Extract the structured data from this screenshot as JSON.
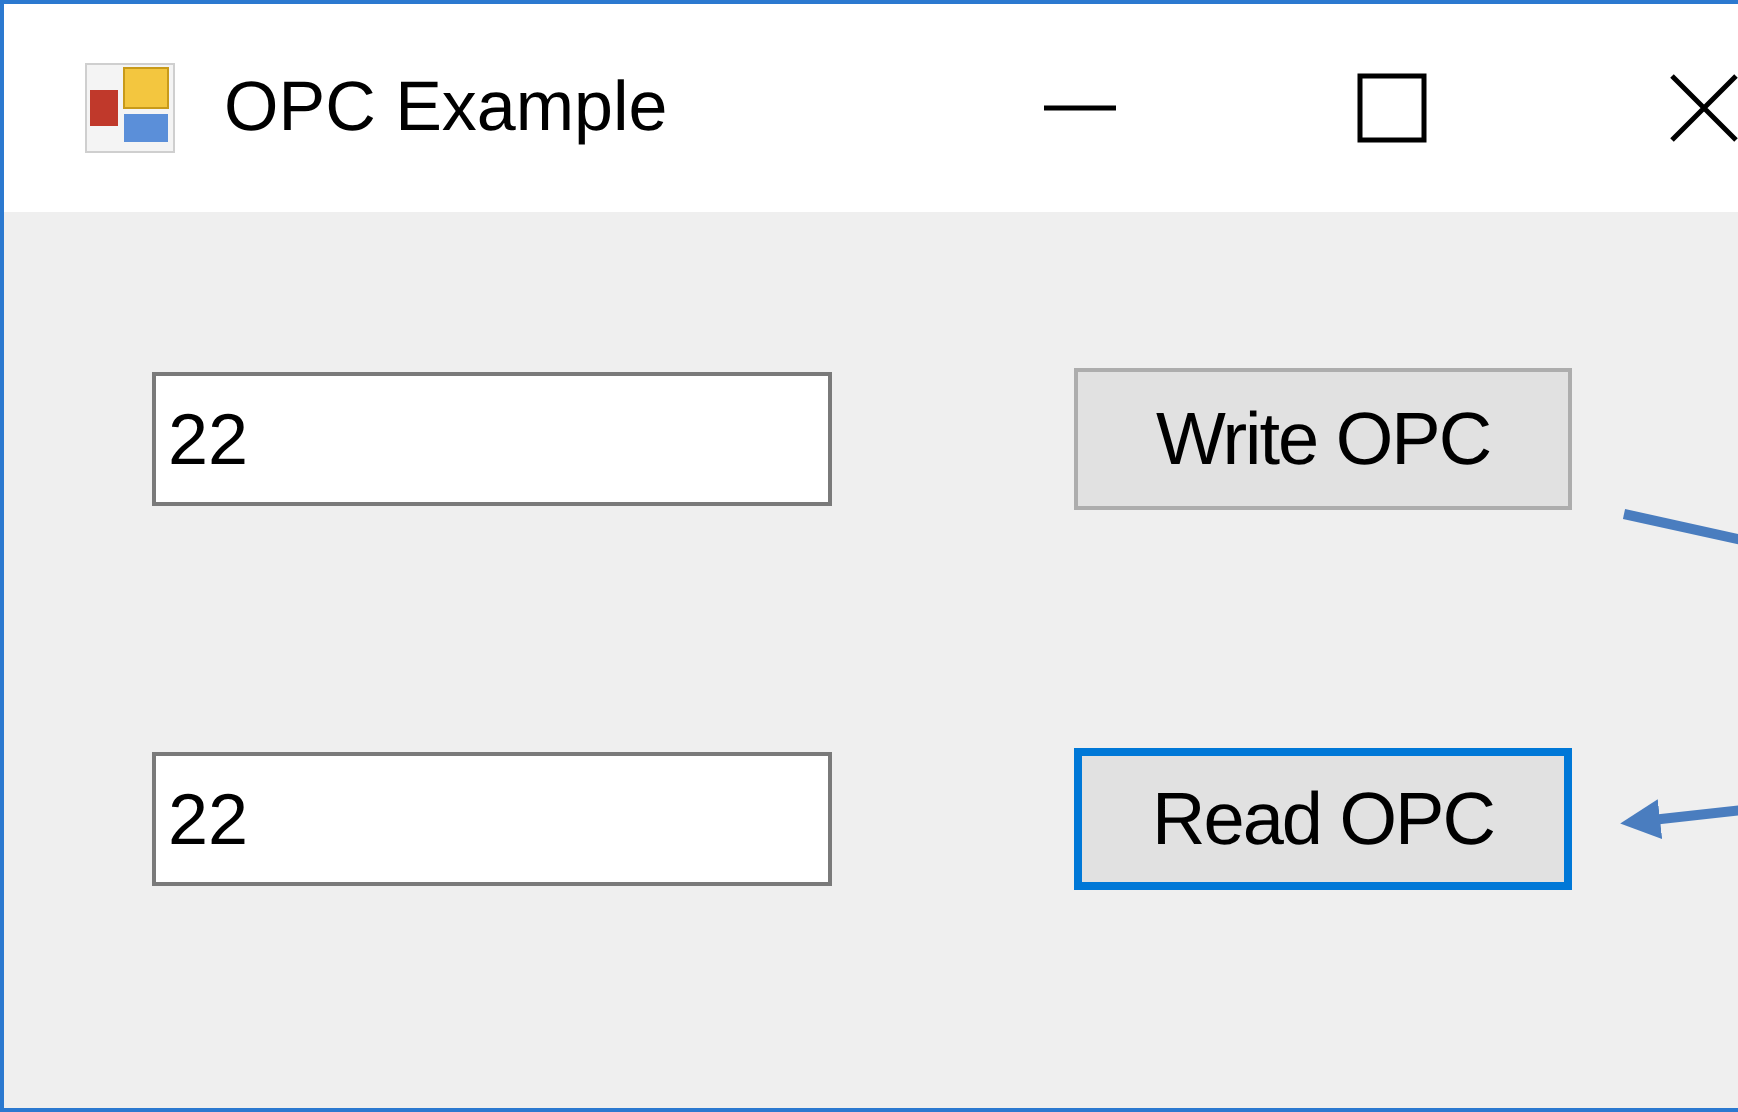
{
  "window": {
    "title": "OPC Example",
    "controls": [
      {
        "kind": "minimize"
      },
      {
        "kind": "maximize"
      },
      {
        "kind": "close"
      }
    ]
  },
  "rows": [
    {
      "field": {
        "value": "22"
      },
      "button": {
        "label": "Write OPC",
        "focused": false
      }
    },
    {
      "field": {
        "value": "22"
      },
      "button": {
        "label": "Read OPC",
        "focused": true
      }
    }
  ],
  "annotations": [
    {
      "kind": "line"
    },
    {
      "kind": "arrow"
    }
  ]
}
